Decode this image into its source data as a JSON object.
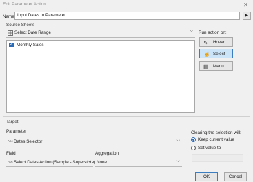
{
  "window": {
    "title": "Edit Parameter Action",
    "close_glyph": "✕"
  },
  "name": {
    "label": "Name:",
    "value": "Input Dates to Parameter",
    "menu_glyph": "▶"
  },
  "source": {
    "section_title": "Source Sheets",
    "sheet_selector": {
      "value": "Select Date Range",
      "icon": "grid-icon"
    },
    "sheets": [
      {
        "label": "Monthly Sales",
        "checked": true
      }
    ]
  },
  "run_action": {
    "label": "Run action on:",
    "options": [
      {
        "label": "Hover",
        "icon": "pointer-icon",
        "glyph": "⇖",
        "selected": false
      },
      {
        "label": "Select",
        "icon": "click-hand-icon",
        "glyph": "☝",
        "selected": true
      },
      {
        "label": "Menu",
        "icon": "menu-icon",
        "glyph": "▤",
        "selected": false
      }
    ]
  },
  "target": {
    "section_title": "Target",
    "parameter": {
      "label": "Parameter",
      "type_tag": "Abc",
      "value": "Dates Selector"
    },
    "field": {
      "label": "Field",
      "type_tag": "Abc",
      "value": "Select Dates Action (Sample - Superstore)"
    },
    "aggregation": {
      "label": "Aggregation",
      "value": "None"
    }
  },
  "clearing": {
    "label": "Clearing the selection will:",
    "options": [
      {
        "label": "Keep current value",
        "selected": true
      },
      {
        "label": "Set value to",
        "selected": false
      }
    ],
    "set_value": ""
  },
  "buttons": {
    "ok": "OK",
    "cancel": "Cancel"
  },
  "colors": {
    "accent": "#2c6ab4",
    "selected_button": "#cce4f7",
    "background": "#f0f0f0"
  }
}
